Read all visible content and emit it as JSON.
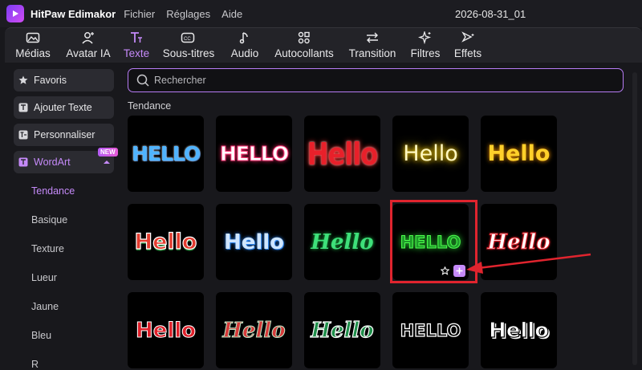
{
  "app": {
    "name": "HitPaw Edimakor",
    "project": "2026-08-31_01",
    "menus": [
      "Fichier",
      "Réglages",
      "Aide"
    ]
  },
  "toolbar": [
    {
      "label": "Médias",
      "icon": "media-icon"
    },
    {
      "label": "Avatar IA",
      "icon": "avatar-icon"
    },
    {
      "label": "Texte",
      "icon": "text-icon"
    },
    {
      "label": "Sous-titres",
      "icon": "subtitles-icon"
    },
    {
      "label": "Audio",
      "icon": "audio-icon"
    },
    {
      "label": "Autocollants",
      "icon": "stickers-icon"
    },
    {
      "label": "Transition",
      "icon": "transition-icon"
    },
    {
      "label": "Filtres",
      "icon": "filters-icon"
    },
    {
      "label": "Effets",
      "icon": "effects-icon"
    }
  ],
  "active_tool": "Texte",
  "sidebar": {
    "buttons": [
      {
        "label": "Favoris",
        "icon": "star-icon"
      },
      {
        "label": "Ajouter Texte",
        "icon": "add-text-icon"
      },
      {
        "label": "Personnaliser",
        "icon": "customize-icon"
      },
      {
        "label": "WordArt",
        "icon": "wordart-icon"
      }
    ],
    "new_badge": "NEW",
    "submenu": [
      "Tendance",
      "Basique",
      "Texture",
      "Lueur",
      "Jaune",
      "Bleu",
      "R"
    ]
  },
  "search": {
    "placeholder": "Rechercher"
  },
  "section_title": "Tendance",
  "tiles": [
    {
      "text": "HELLO",
      "color": "#4fb4ff",
      "style": "icy-blue"
    },
    {
      "text": "HELLO",
      "color": "#ffffff",
      "style": "pink-drip"
    },
    {
      "text": "Hello",
      "color": "#ff3b3b",
      "style": "red-glow"
    },
    {
      "text": "Hello",
      "color": "#fff3a0",
      "style": "yellow-neon"
    },
    {
      "text": "Hello",
      "color": "#ffd02a",
      "style": "gold-glow"
    },
    {
      "text": "Hello",
      "color": "#e23b2e",
      "style": "tricolor"
    },
    {
      "text": "Hello",
      "color": "#cfe6ff",
      "style": "blue-metal"
    },
    {
      "text": "Hello",
      "color": "#3ee07a",
      "style": "green-script"
    },
    {
      "text": "HELLO",
      "color": "#2ee83b",
      "style": "green-neon"
    },
    {
      "text": "Hello",
      "color": "#ffffff",
      "style": "red-script"
    },
    {
      "text": "Hello",
      "color": "#e0202a",
      "style": "red-outline"
    },
    {
      "text": "Hello",
      "color": "#d63a3a",
      "style": "red-green-script"
    },
    {
      "text": "Hello",
      "color": "#1f8f4a",
      "style": "green-white-script"
    },
    {
      "text": "HELLO",
      "color": "#000000",
      "style": "white-outline"
    },
    {
      "text": "Hello",
      "color": "#ffffff",
      "style": "black-outline"
    }
  ],
  "colors": {
    "accent": "#c58af9",
    "highlight": "#e0242e"
  }
}
